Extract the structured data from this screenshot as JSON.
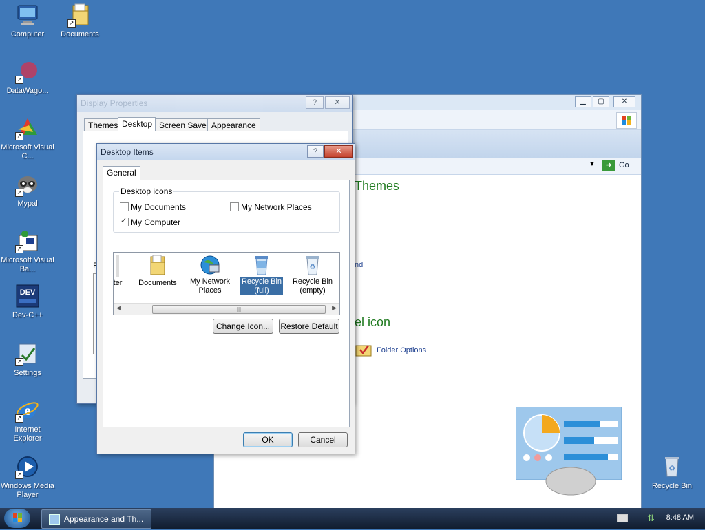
{
  "desktop": {
    "icons": [
      {
        "label": "Computer"
      },
      {
        "label": "Documents"
      },
      {
        "label": "DataWago..."
      },
      {
        "label": "Microsoft Visual C..."
      },
      {
        "label": "Mypal"
      },
      {
        "label": "Microsoft Visual Ba..."
      },
      {
        "label": "Dev-C++"
      },
      {
        "label": "Settings"
      },
      {
        "label": "Internet Explorer"
      },
      {
        "label": "Windows Media Player"
      },
      {
        "label": "Recycle Bin"
      }
    ]
  },
  "explorer": {
    "go_label": "Go",
    "heading_themes": "Themes",
    "heading_panel": "el icon",
    "link_partial": "nd",
    "folder_options": "Folder Options"
  },
  "display_properties": {
    "title": "Display Properties",
    "tabs": [
      "Themes",
      "Desktop",
      "Screen Saver",
      "Appearance"
    ],
    "active_tab": "Desktop",
    "partial_label": "B"
  },
  "desktop_items": {
    "title": "Desktop Items",
    "tab": "General",
    "group_label": "Desktop icons",
    "checkboxes": [
      {
        "label": "My Documents",
        "checked": false
      },
      {
        "label": "My Network Places",
        "checked": false
      },
      {
        "label": "My Computer",
        "checked": true
      }
    ],
    "icon_list": [
      {
        "label": "ter"
      },
      {
        "label": "Documents"
      },
      {
        "label": "My Network Places"
      },
      {
        "label": "Recycle Bin (full)",
        "selected": true
      },
      {
        "label": "Recycle Bin (empty)"
      }
    ],
    "change_icon": "Change Icon...",
    "restore_default": "Restore Default",
    "ok": "OK",
    "cancel": "Cancel"
  },
  "taskbar": {
    "task_label": "Appearance and Th...",
    "clock": "8:48 AM"
  },
  "colors": {
    "desktop": "#3f78b8",
    "accent_green": "#1f7a1f",
    "selection": "#3a6ea5"
  }
}
